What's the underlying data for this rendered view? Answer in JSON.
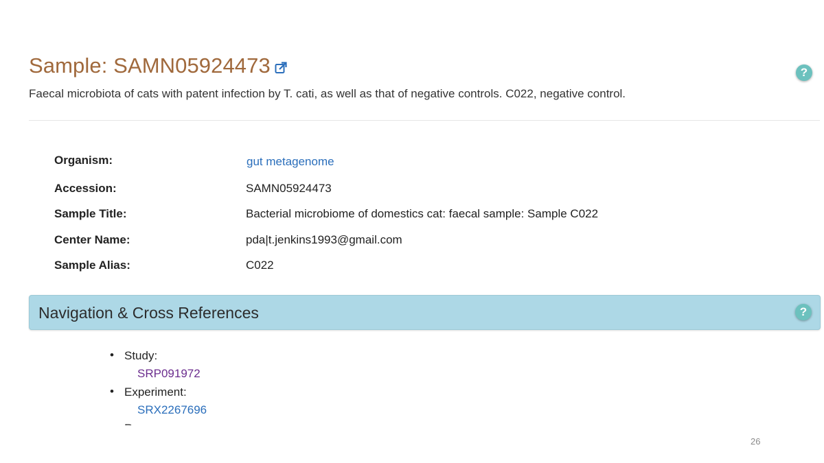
{
  "page": {
    "title": "Sample: SAMN05924473",
    "description": "Faecal microbiota of cats with patent infection by T. cati, as well as that of negative controls. C022, negative control."
  },
  "help_label": "?",
  "attributes": [
    {
      "label": "Organism:",
      "value": "gut metagenome"
    },
    {
      "label": "Accession:",
      "value": "SAMN05924473"
    },
    {
      "label": "Sample Title:",
      "value": "Bacterial microbiome of domestics cat: faecal sample: Sample C022"
    },
    {
      "label": "Center Name:",
      "value": "pda|t.jenkins1993@gmail.com"
    },
    {
      "label": "Sample Alias:",
      "value": "C022"
    }
  ],
  "navigation": {
    "title": "Navigation & Cross References",
    "items": [
      {
        "label": "Study:",
        "link": "SRP091972"
      },
      {
        "label": "Experiment:",
        "link": "SRX2267696"
      },
      {
        "label": "R"
      }
    ]
  },
  "slide": {
    "page_number": "26"
  },
  "colors": {
    "title": "#a0693c",
    "link": "#2a6ebb",
    "visited_link": "#6b2d8e",
    "panel": "#add8e6",
    "help": "#6cc1be"
  },
  "icons": {
    "external_link": "external-link-icon",
    "help": "help-icon"
  }
}
